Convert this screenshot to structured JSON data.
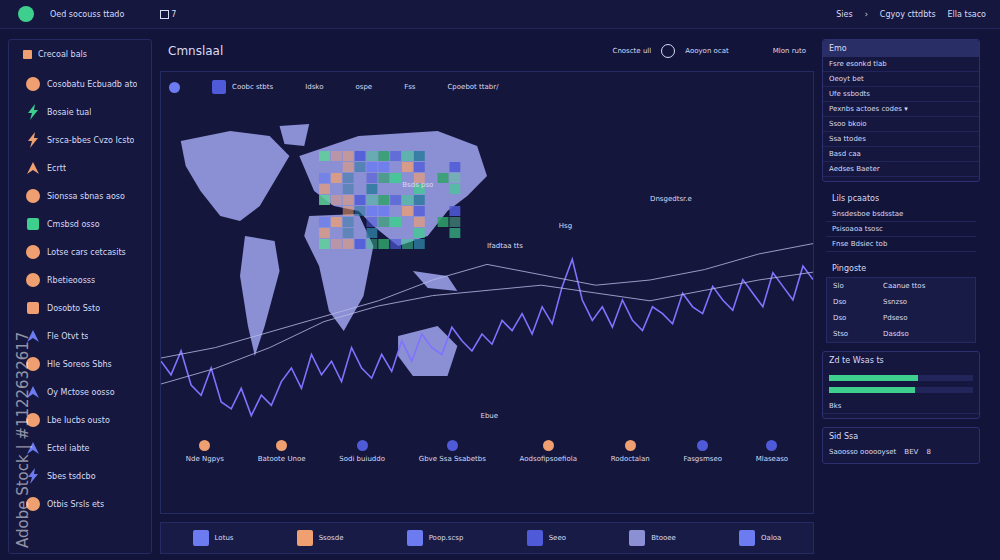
{
  "watermark": "Adobe Stock | #1122632617",
  "topbar": {
    "title": "Oed socouss ttado",
    "count": "7",
    "links": [
      "Sies",
      "›",
      "Cgyoy cttdbts",
      "Ella tsaco"
    ]
  },
  "sidebar": {
    "title": "Crecoal bals",
    "items": [
      {
        "label": "Cosobatu Ecbuadb ato",
        "kind": "circle",
        "color": "#f0a070"
      },
      {
        "label": "Bosaie tual",
        "kind": "bolt",
        "color": "#3ecf8e"
      },
      {
        "label": "Srsca-bbes Cvzo Icsto",
        "kind": "bolt",
        "color": "#f0a070"
      },
      {
        "label": "Ecrtt",
        "kind": "arrow",
        "color": "#f0a070"
      },
      {
        "label": "Sionssa sbnas aoso",
        "kind": "circle",
        "color": "#f0a070"
      },
      {
        "label": "Cmsbsd osso",
        "kind": "square",
        "color": "#3ecf8e"
      },
      {
        "label": "Lotse cars cetcasits",
        "kind": "circle",
        "color": "#f0a070"
      },
      {
        "label": "Rbetieoosss",
        "kind": "circle",
        "color": "#f0a070"
      },
      {
        "label": "Dosobto Ssto",
        "kind": "square",
        "color": "#f0a070"
      },
      {
        "label": "Fle Otvt ts",
        "kind": "arrow",
        "color": "#6c7cf0"
      },
      {
        "label": "Hle Soreos Sbhs",
        "kind": "circle",
        "color": "#f0a070"
      },
      {
        "label": "Oy Mctose oosso",
        "kind": "arrow",
        "color": "#6c7cf0"
      },
      {
        "label": "Lbe Iucbs ousto",
        "kind": "circle",
        "color": "#f0a070"
      },
      {
        "label": "Ectel iabte",
        "kind": "arrow",
        "color": "#6c7cf0"
      },
      {
        "label": "Sbes tsdcbo",
        "kind": "bolt",
        "color": "#6c7cf0"
      },
      {
        "label": "Otbis Srsls ets",
        "kind": "circle",
        "color": "#f0a070"
      }
    ]
  },
  "main": {
    "title": "Cmnslaal",
    "actions": [
      "Cnoscte ull",
      "Aooyon ocat",
      "Mlon ruto"
    ]
  },
  "toolbar": [
    {
      "label": "Coobc stbts",
      "color": "#4f5ad8"
    },
    {
      "label": "Idsko",
      "color": ""
    },
    {
      "label": "ospe",
      "color": ""
    },
    {
      "label": "Fss",
      "color": ""
    },
    {
      "label": "Cpoebot ttabr/",
      "color": ""
    }
  ],
  "chart": {
    "annotations": [
      {
        "label": "Dnsgedtsr.e",
        "x": 0.75,
        "y": 0.29
      },
      {
        "label": "Hsg",
        "x": 0.61,
        "y": 0.37
      },
      {
        "label": "Ifadtaa tts",
        "x": 0.5,
        "y": 0.43
      },
      {
        "label": "Bsds pso",
        "x": 0.37,
        "y": 0.25
      },
      {
        "label": "Ebue",
        "x": 0.49,
        "y": 0.93
      }
    ],
    "series": [
      {
        "name": "main",
        "values": [
          22,
          18,
          25,
          15,
          12,
          20,
          10,
          8,
          14,
          6,
          12,
          9,
          16,
          20,
          14,
          24,
          18,
          22,
          16,
          26,
          20,
          17,
          24,
          19,
          28,
          22,
          30,
          26,
          24,
          32,
          28,
          25,
          30,
          27,
          34,
          31,
          36,
          30,
          38,
          33,
          44,
          52,
          40,
          34,
          38,
          32,
          40,
          34,
          31,
          38,
          36,
          33,
          42,
          38,
          36,
          44,
          40,
          37,
          46,
          42,
          38,
          48,
          44,
          40,
          50,
          46
        ]
      },
      {
        "name": "upper",
        "values": [
          30,
          34,
          40,
          46,
          52,
          60,
          66,
          62,
          58,
          60,
          64,
          70,
          74
        ]
      },
      {
        "name": "middle",
        "values": [
          20,
          26,
          34,
          44,
          50,
          54,
          56,
          58,
          55,
          52,
          56,
          60,
          63
        ]
      }
    ]
  },
  "legend": [
    {
      "label": "Nde Ngpys",
      "color": "#f0a070"
    },
    {
      "label": "Batoote Unoe",
      "color": "#f0a070"
    },
    {
      "label": "Sodi buiuddo",
      "color": "#4f5ad8"
    },
    {
      "label": "Gbve Ssa Ssabetbs",
      "color": "#4f5ad8"
    },
    {
      "label": "Aodsofipsoefiola",
      "color": "#f0a070"
    },
    {
      "label": "Rodoctalan",
      "color": "#f0a070"
    },
    {
      "label": "Fasgsmseo",
      "color": "#4f5ad8"
    },
    {
      "label": "Mlaseaso",
      "color": "#4f5ad8"
    }
  ],
  "bottom": [
    {
      "label": "Lotus",
      "color": "#6c7cf0"
    },
    {
      "label": "Ssosde",
      "color": "#f0a070"
    },
    {
      "label": "Poop.scsp",
      "color": "#6c7cf0"
    },
    {
      "label": "Seeo",
      "color": "#4f5ad8"
    },
    {
      "label": "Btooee",
      "color": "#8b8fd4"
    },
    {
      "label": "Oaloa",
      "color": "#6c7cf0"
    }
  ],
  "right": {
    "panel1": {
      "title": "Emo",
      "rows": [
        "Fsre esonkd tlab",
        "Oeoyt bet",
        "Ufe ssbodts",
        "Pexnbs actoes codes ▾",
        "Ssoo bkoio",
        "Ssa ttodes",
        "Basd caa",
        "Aedses Baeter"
      ]
    },
    "panel2": {
      "title": "Lils pcaatos",
      "rows": [
        "Snsdesboe bsdsstae",
        "Psisoaoa tsosc",
        "Fnse Bdsiec tob"
      ]
    },
    "panel3": {
      "title": "Pingoste",
      "rows": [
        [
          "Slo",
          "Caanue ttos"
        ],
        [
          "Dso",
          "Ssnzso"
        ],
        [
          "Dso",
          "Pdseso"
        ],
        [
          "Stso",
          "Dasdso"
        ]
      ]
    },
    "panel4": {
      "title": "Zd te Wsas ts",
      "bars": [
        {
          "level": 0.62
        },
        {
          "level": 0.6
        }
      ],
      "footer": "Bks"
    },
    "panel5": {
      "title": "Sid Ssa",
      "text": "Saoosso oooooyset",
      "code": "BEV",
      "num": "8"
    }
  }
}
